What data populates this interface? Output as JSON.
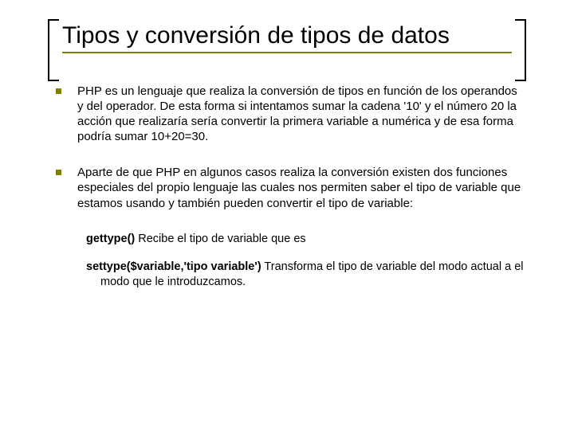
{
  "title": "Tipos y conversión de tipos de datos",
  "bullets": [
    "PHP es un lenguaje que realiza la conversión de tipos en función de los operandos y del operador. De esta forma si intentamos sumar la cadena '10' y el número 20 la acción que realizaría sería convertir la primera variable a numérica y de esa forma podría sumar 10+20=30.",
    "Aparte de que PHP en algunos casos realiza la conversión existen dos funciones especiales del propio lenguaje las cuales nos permiten saber el tipo de variable que estamos usando y también pueden convertir el tipo de variable:"
  ],
  "subs": [
    {
      "fn": "gettype()",
      "desc": " Recibe el tipo de variable que es"
    },
    {
      "fn": "settype($variable,'tipo variable')",
      "desc": " Transforma el tipo de variable del modo actual a el modo que le introduzcamos."
    }
  ]
}
